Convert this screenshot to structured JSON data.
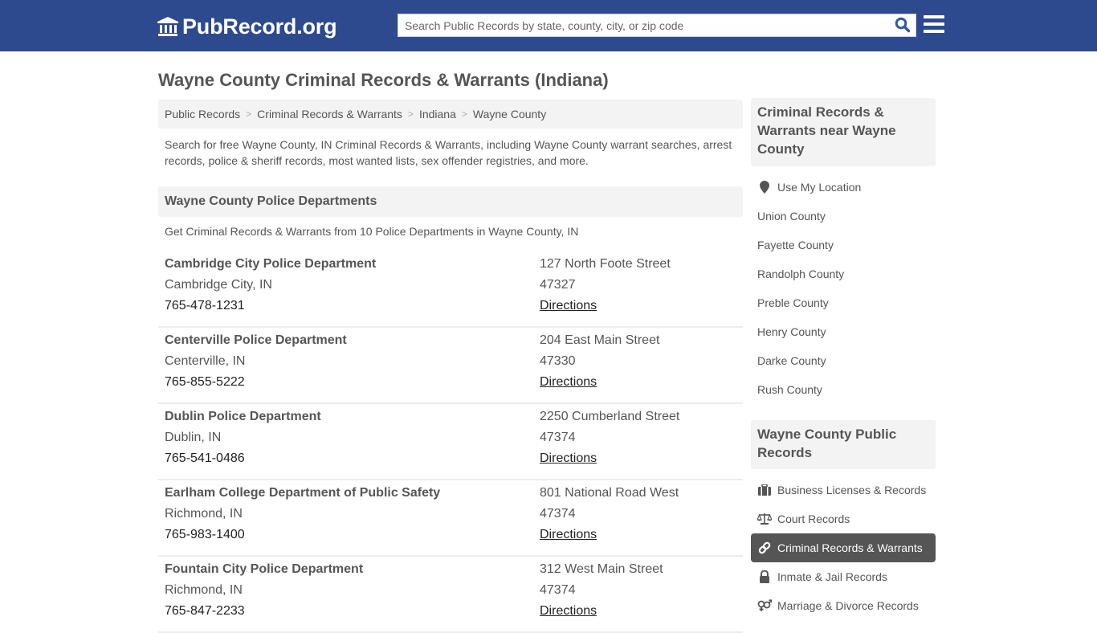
{
  "header": {
    "logo_text": "PubRecord.org",
    "search_placeholder": "Search Public Records by state, county, city, or zip code",
    "brand_color": "#2e4a8e"
  },
  "page": {
    "title": "Wayne County Criminal Records & Warrants (Indiana)",
    "breadcrumb": [
      "Public Records",
      "Criminal Records & Warrants",
      "Indiana",
      "Wayne County"
    ],
    "intro": "Search for free Wayne County, IN Criminal Records & Warrants, including Wayne County warrant searches, arrest records, police & sheriff records, most wanted lists, sex offender registries, and more."
  },
  "departments_section": {
    "heading": "Wayne County Police Departments",
    "subheading": "Get Criminal Records & Warrants from 10 Police Departments in Wayne County, IN",
    "directions_label": "Directions",
    "items": [
      {
        "name": "Cambridge City Police Department",
        "city": "Cambridge City, IN",
        "phone": "765-478-1231",
        "address": "127 North Foote Street",
        "zip": "47327"
      },
      {
        "name": "Centerville Police Department",
        "city": "Centerville, IN",
        "phone": "765-855-5222",
        "address": "204 East Main Street",
        "zip": "47330"
      },
      {
        "name": "Dublin Police Department",
        "city": "Dublin, IN",
        "phone": "765-541-0486",
        "address": "2250 Cumberland Street",
        "zip": "47374"
      },
      {
        "name": "Earlham College Department of Public Safety",
        "city": "Richmond, IN",
        "phone": "765-983-1400",
        "address": "801 National Road West",
        "zip": "47374"
      },
      {
        "name": "Fountain City Police Department",
        "city": "Richmond, IN",
        "phone": "765-847-2233",
        "address": "312 West Main Street",
        "zip": "47374"
      }
    ]
  },
  "sidebar": {
    "nearby": {
      "heading": "Criminal Records & Warrants near Wayne County",
      "use_location": "Use My Location",
      "counties": [
        "Union County",
        "Fayette County",
        "Randolph County",
        "Preble County",
        "Henry County",
        "Darke County",
        "Rush County"
      ]
    },
    "public_records": {
      "heading": "Wayne County Public Records",
      "items": [
        {
          "label": "Business Licenses & Records",
          "icon": "briefcase-icon",
          "active": false
        },
        {
          "label": "Court Records",
          "icon": "scales-icon",
          "active": false
        },
        {
          "label": "Criminal Records & Warrants",
          "icon": "link-icon",
          "active": true
        },
        {
          "label": "Inmate & Jail Records",
          "icon": "lock-icon",
          "active": false
        },
        {
          "label": "Marriage & Divorce Records",
          "icon": "gender-icon",
          "active": false
        }
      ]
    }
  }
}
